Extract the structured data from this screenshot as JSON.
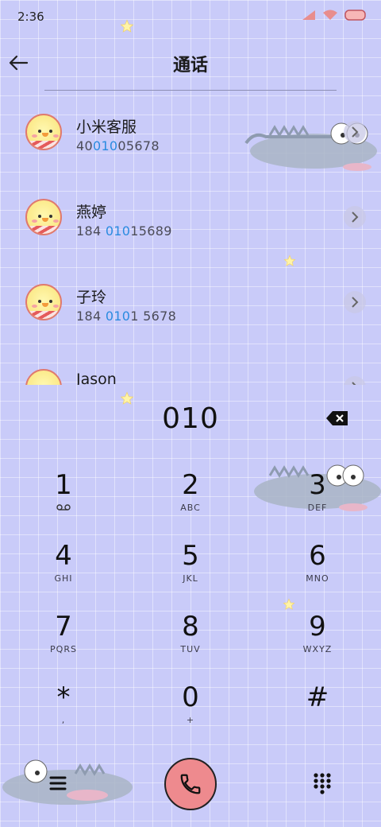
{
  "status_bar": {
    "time": "2:36"
  },
  "header": {
    "title": "通话"
  },
  "contacts": [
    {
      "name": "小米客服",
      "number_parts": [
        "40",
        "010",
        "05678"
      ]
    },
    {
      "name": "燕婷",
      "number_parts": [
        "184 ",
        "010",
        "15689"
      ]
    },
    {
      "name": "子玲",
      "number_parts": [
        "184 ",
        "010",
        "1 5678"
      ]
    },
    {
      "name": "Jason",
      "number_parts": [
        "",
        "",
        ""
      ]
    }
  ],
  "dialer": {
    "entered_number": "010"
  },
  "keypad": [
    {
      "digit": "1",
      "letters": ""
    },
    {
      "digit": "2",
      "letters": "ABC"
    },
    {
      "digit": "3",
      "letters": "DEF"
    },
    {
      "digit": "4",
      "letters": "GHI"
    },
    {
      "digit": "5",
      "letters": "JKL"
    },
    {
      "digit": "6",
      "letters": "MNO"
    },
    {
      "digit": "7",
      "letters": "PQRS"
    },
    {
      "digit": "8",
      "letters": "TUV"
    },
    {
      "digit": "9",
      "letters": "WXYZ"
    },
    {
      "digit": "*",
      "letters": ","
    },
    {
      "digit": "0",
      "letters": "+"
    },
    {
      "digit": "#",
      "letters": ""
    }
  ],
  "icons": {
    "back": "back-arrow-icon",
    "backspace": "backspace-icon",
    "call": "phone-icon",
    "menu": "menu-icon",
    "dialpad": "dialpad-icon",
    "voicemail": "voicemail-icon",
    "chevron": "chevron-right-icon"
  },
  "colors": {
    "background": "#c9cbf9",
    "highlight": "#2a8be0",
    "call_button": "#ee8a8e"
  }
}
